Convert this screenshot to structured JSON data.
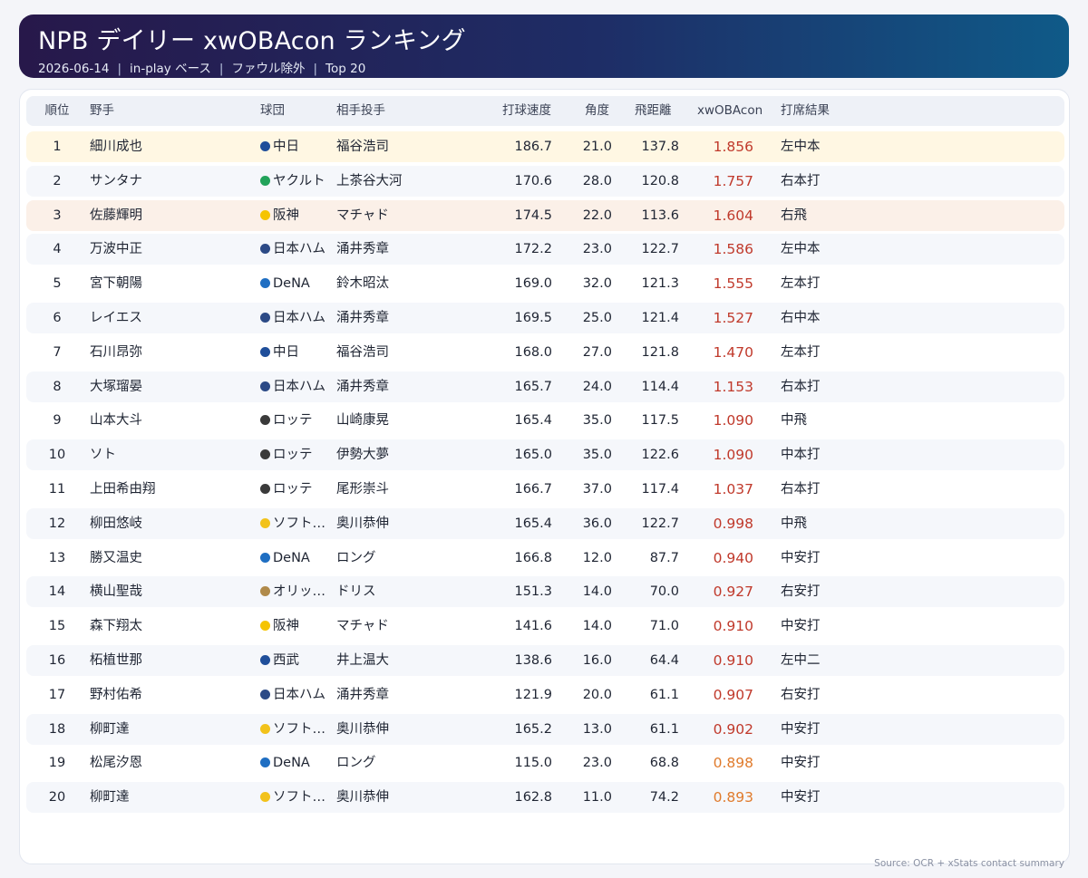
{
  "header": {
    "title": "NPB デイリー xwOBAcon ランキング",
    "date": "2026-06-14",
    "basis": "in-play ベース",
    "filter": "ファウル除外",
    "scope": "Top 20",
    "separator": "|"
  },
  "colors": {
    "header_gradient_start": "#27184a",
    "header_gradient_end": "#0f5a88",
    "xwoba_high": "#c0392b",
    "xwoba_mid": "#e07b2c",
    "rank1_row": "#fff7e3",
    "rank3_row": "#fbf0e8"
  },
  "table": {
    "columns": {
      "rank": "順位",
      "player": "野手",
      "team": "球団",
      "pitcher": "相手投手",
      "speed": "打球速度",
      "angle": "角度",
      "distance": "飛距離",
      "xwoba": "xwOBAcon",
      "result": "打席結果"
    },
    "rows": [
      {
        "rank": "1",
        "player": "細川成也",
        "team": "中日",
        "team_color": "#1f4e9a",
        "pitcher": "福谷浩司",
        "speed": "186.7",
        "angle": "21.0",
        "distance": "137.8",
        "xwoba": "1.856",
        "xwoba_color": "#c0392b",
        "result": "左中本",
        "highlight": "gold"
      },
      {
        "rank": "2",
        "player": "サンタナ",
        "team": "ヤクルト",
        "team_color": "#22a35a",
        "pitcher": "上茶谷大河",
        "speed": "170.6",
        "angle": "28.0",
        "distance": "120.8",
        "xwoba": "1.757",
        "xwoba_color": "#c0392b",
        "result": "右本打",
        "highlight": ""
      },
      {
        "rank": "3",
        "player": "佐藤輝明",
        "team": "阪神",
        "team_color": "#f5c400",
        "pitcher": "マチャド",
        "speed": "174.5",
        "angle": "22.0",
        "distance": "113.6",
        "xwoba": "1.604",
        "xwoba_color": "#c0392b",
        "result": "右飛",
        "highlight": "bronze"
      },
      {
        "rank": "4",
        "player": "万波中正",
        "team": "日本ハム",
        "team_color": "#2c4a86",
        "pitcher": "涌井秀章",
        "speed": "172.2",
        "angle": "23.0",
        "distance": "122.7",
        "xwoba": "1.586",
        "xwoba_color": "#c0392b",
        "result": "左中本",
        "highlight": ""
      },
      {
        "rank": "5",
        "player": "宮下朝陽",
        "team": "DeNA",
        "team_color": "#1f6ec2",
        "pitcher": "鈴木昭汰",
        "speed": "169.0",
        "angle": "32.0",
        "distance": "121.3",
        "xwoba": "1.555",
        "xwoba_color": "#c0392b",
        "result": "左本打",
        "highlight": ""
      },
      {
        "rank": "6",
        "player": "レイエス",
        "team": "日本ハム",
        "team_color": "#2c4a86",
        "pitcher": "涌井秀章",
        "speed": "169.5",
        "angle": "25.0",
        "distance": "121.4",
        "xwoba": "1.527",
        "xwoba_color": "#c0392b",
        "result": "右中本",
        "highlight": ""
      },
      {
        "rank": "7",
        "player": "石川昂弥",
        "team": "中日",
        "team_color": "#1f4e9a",
        "pitcher": "福谷浩司",
        "speed": "168.0",
        "angle": "27.0",
        "distance": "121.8",
        "xwoba": "1.470",
        "xwoba_color": "#c0392b",
        "result": "左本打",
        "highlight": ""
      },
      {
        "rank": "8",
        "player": "大塚瑠晏",
        "team": "日本ハム",
        "team_color": "#2c4a86",
        "pitcher": "涌井秀章",
        "speed": "165.7",
        "angle": "24.0",
        "distance": "114.4",
        "xwoba": "1.153",
        "xwoba_color": "#c0392b",
        "result": "右本打",
        "highlight": ""
      },
      {
        "rank": "9",
        "player": "山本大斗",
        "team": "ロッテ",
        "team_color": "#3a3a3a",
        "pitcher": "山崎康晃",
        "speed": "165.4",
        "angle": "35.0",
        "distance": "117.5",
        "xwoba": "1.090",
        "xwoba_color": "#c0392b",
        "result": "中飛",
        "highlight": ""
      },
      {
        "rank": "10",
        "player": "ソト",
        "team": "ロッテ",
        "team_color": "#3a3a3a",
        "pitcher": "伊勢大夢",
        "speed": "165.0",
        "angle": "35.0",
        "distance": "122.6",
        "xwoba": "1.090",
        "xwoba_color": "#c0392b",
        "result": "中本打",
        "highlight": ""
      },
      {
        "rank": "11",
        "player": "上田希由翔",
        "team": "ロッテ",
        "team_color": "#3a3a3a",
        "pitcher": "尾形崇斗",
        "speed": "166.7",
        "angle": "37.0",
        "distance": "117.4",
        "xwoba": "1.037",
        "xwoba_color": "#c0392b",
        "result": "右本打",
        "highlight": ""
      },
      {
        "rank": "12",
        "player": "柳田悠岐",
        "team": "ソフト…",
        "team_color": "#f2c21b",
        "pitcher": "奥川恭伸",
        "speed": "165.4",
        "angle": "36.0",
        "distance": "122.7",
        "xwoba": "0.998",
        "xwoba_color": "#c0392b",
        "result": "中飛",
        "highlight": ""
      },
      {
        "rank": "13",
        "player": "勝又温史",
        "team": "DeNA",
        "team_color": "#1f6ec2",
        "pitcher": "ロング",
        "speed": "166.8",
        "angle": "12.0",
        "distance": "87.7",
        "xwoba": "0.940",
        "xwoba_color": "#c0392b",
        "result": "中安打",
        "highlight": ""
      },
      {
        "rank": "14",
        "player": "横山聖哉",
        "team": "オリッ…",
        "team_color": "#b08a4a",
        "pitcher": "ドリス",
        "speed": "151.3",
        "angle": "14.0",
        "distance": "70.0",
        "xwoba": "0.927",
        "xwoba_color": "#c0392b",
        "result": "右安打",
        "highlight": ""
      },
      {
        "rank": "15",
        "player": "森下翔太",
        "team": "阪神",
        "team_color": "#f5c400",
        "pitcher": "マチャド",
        "speed": "141.6",
        "angle": "14.0",
        "distance": "71.0",
        "xwoba": "0.910",
        "xwoba_color": "#c0392b",
        "result": "中安打",
        "highlight": ""
      },
      {
        "rank": "16",
        "player": "柘植世那",
        "team": "西武",
        "team_color": "#1f4e9a",
        "pitcher": "井上温大",
        "speed": "138.6",
        "angle": "16.0",
        "distance": "64.4",
        "xwoba": "0.910",
        "xwoba_color": "#c0392b",
        "result": "左中二",
        "highlight": ""
      },
      {
        "rank": "17",
        "player": "野村佑希",
        "team": "日本ハム",
        "team_color": "#2c4a86",
        "pitcher": "涌井秀章",
        "speed": "121.9",
        "angle": "20.0",
        "distance": "61.1",
        "xwoba": "0.907",
        "xwoba_color": "#c0392b",
        "result": "右安打",
        "highlight": ""
      },
      {
        "rank": "18",
        "player": "柳町達",
        "team": "ソフト…",
        "team_color": "#f2c21b",
        "pitcher": "奥川恭伸",
        "speed": "165.2",
        "angle": "13.0",
        "distance": "61.1",
        "xwoba": "0.902",
        "xwoba_color": "#c0392b",
        "result": "中安打",
        "highlight": ""
      },
      {
        "rank": "19",
        "player": "松尾汐恩",
        "team": "DeNA",
        "team_color": "#1f6ec2",
        "pitcher": "ロング",
        "speed": "115.0",
        "angle": "23.0",
        "distance": "68.8",
        "xwoba": "0.898",
        "xwoba_color": "#e07b2c",
        "result": "中安打",
        "highlight": ""
      },
      {
        "rank": "20",
        "player": "柳町達",
        "team": "ソフト…",
        "team_color": "#f2c21b",
        "pitcher": "奥川恭伸",
        "speed": "162.8",
        "angle": "11.0",
        "distance": "74.2",
        "xwoba": "0.893",
        "xwoba_color": "#e07b2c",
        "result": "中安打",
        "highlight": ""
      }
    ]
  },
  "footer": {
    "source": "Source: OCR + xStats contact summary"
  }
}
